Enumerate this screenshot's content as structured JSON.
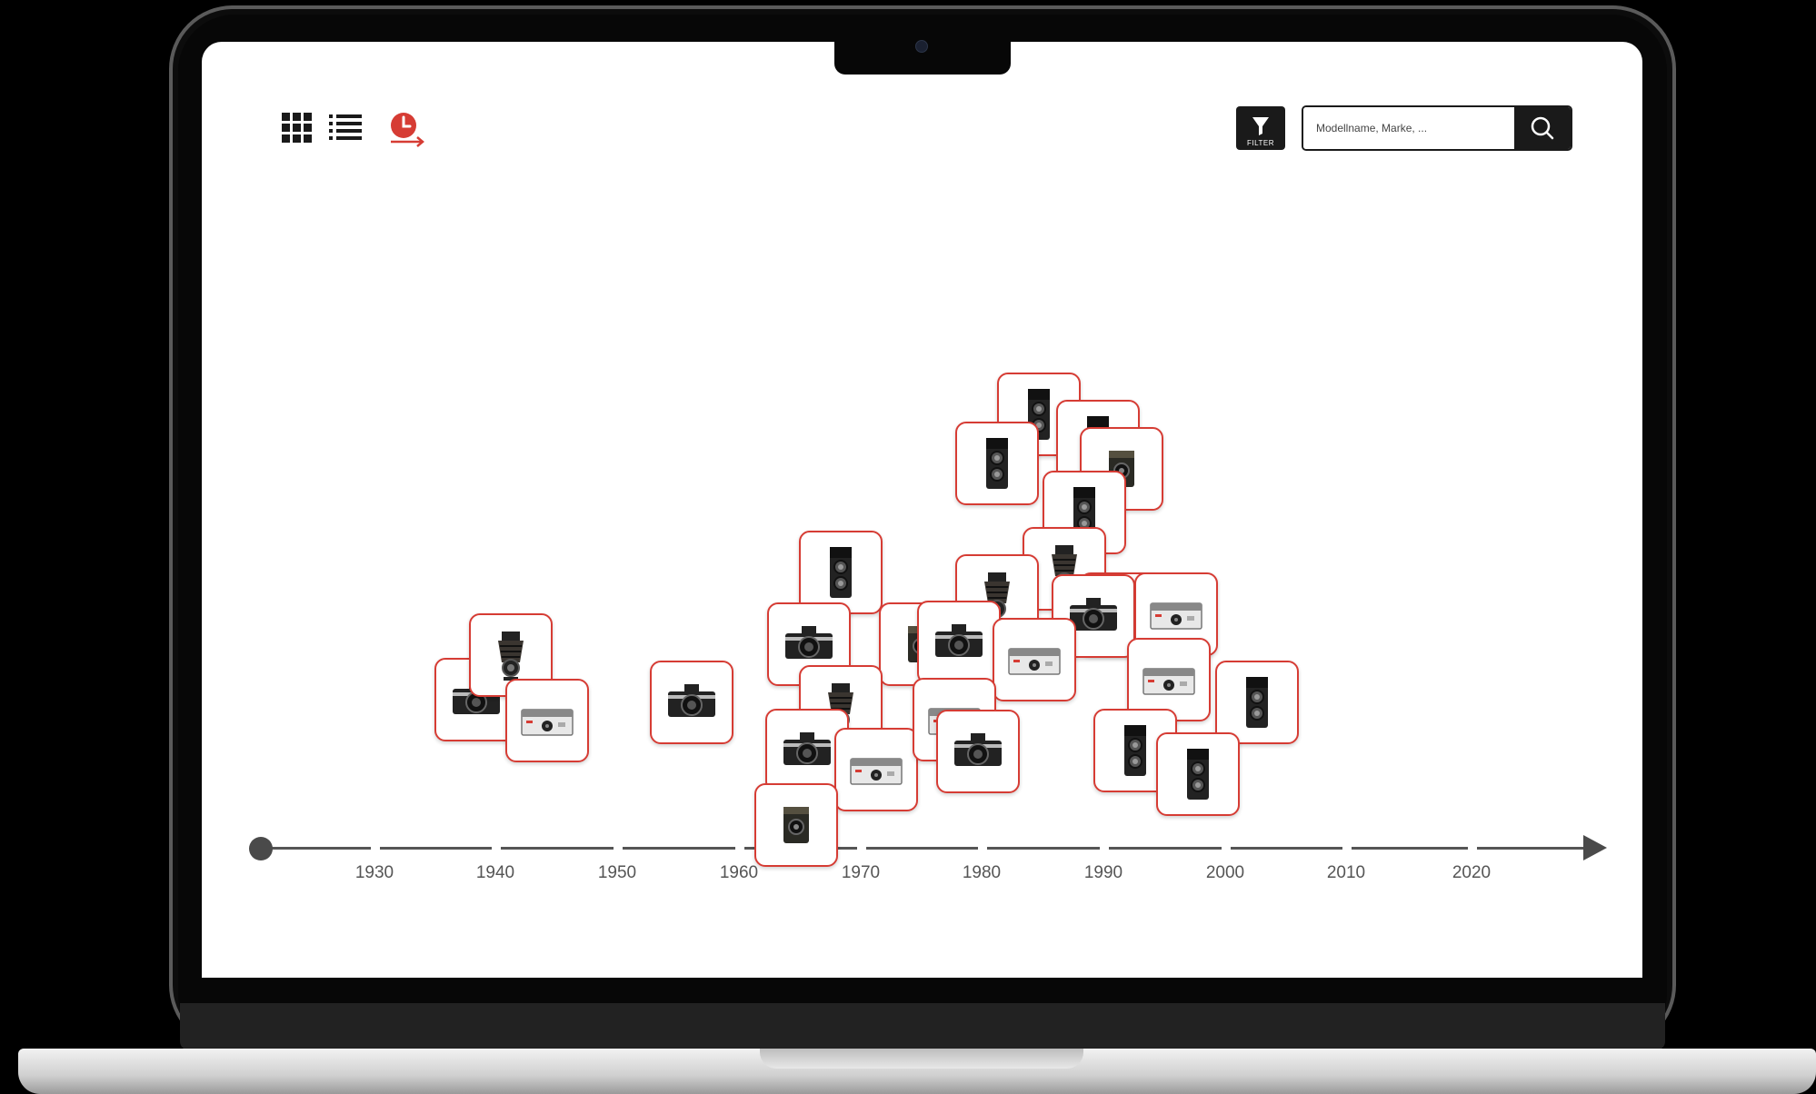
{
  "toolbar": {
    "filter_label": "FILTER",
    "search_placeholder": "Modellname, Marke, ..."
  },
  "views": {
    "grid": "grid-view-icon",
    "list": "list-view-icon",
    "timeline": "timeline-view-icon",
    "active": "timeline"
  },
  "timeline": {
    "decades": [
      "1930",
      "1940",
      "1950",
      "1960",
      "1970",
      "1980",
      "1990",
      "2000",
      "2010",
      "2020"
    ]
  },
  "colors": {
    "accent": "#d63c34",
    "dark": "#1a1a1a",
    "axis": "#4a4a4a"
  }
}
